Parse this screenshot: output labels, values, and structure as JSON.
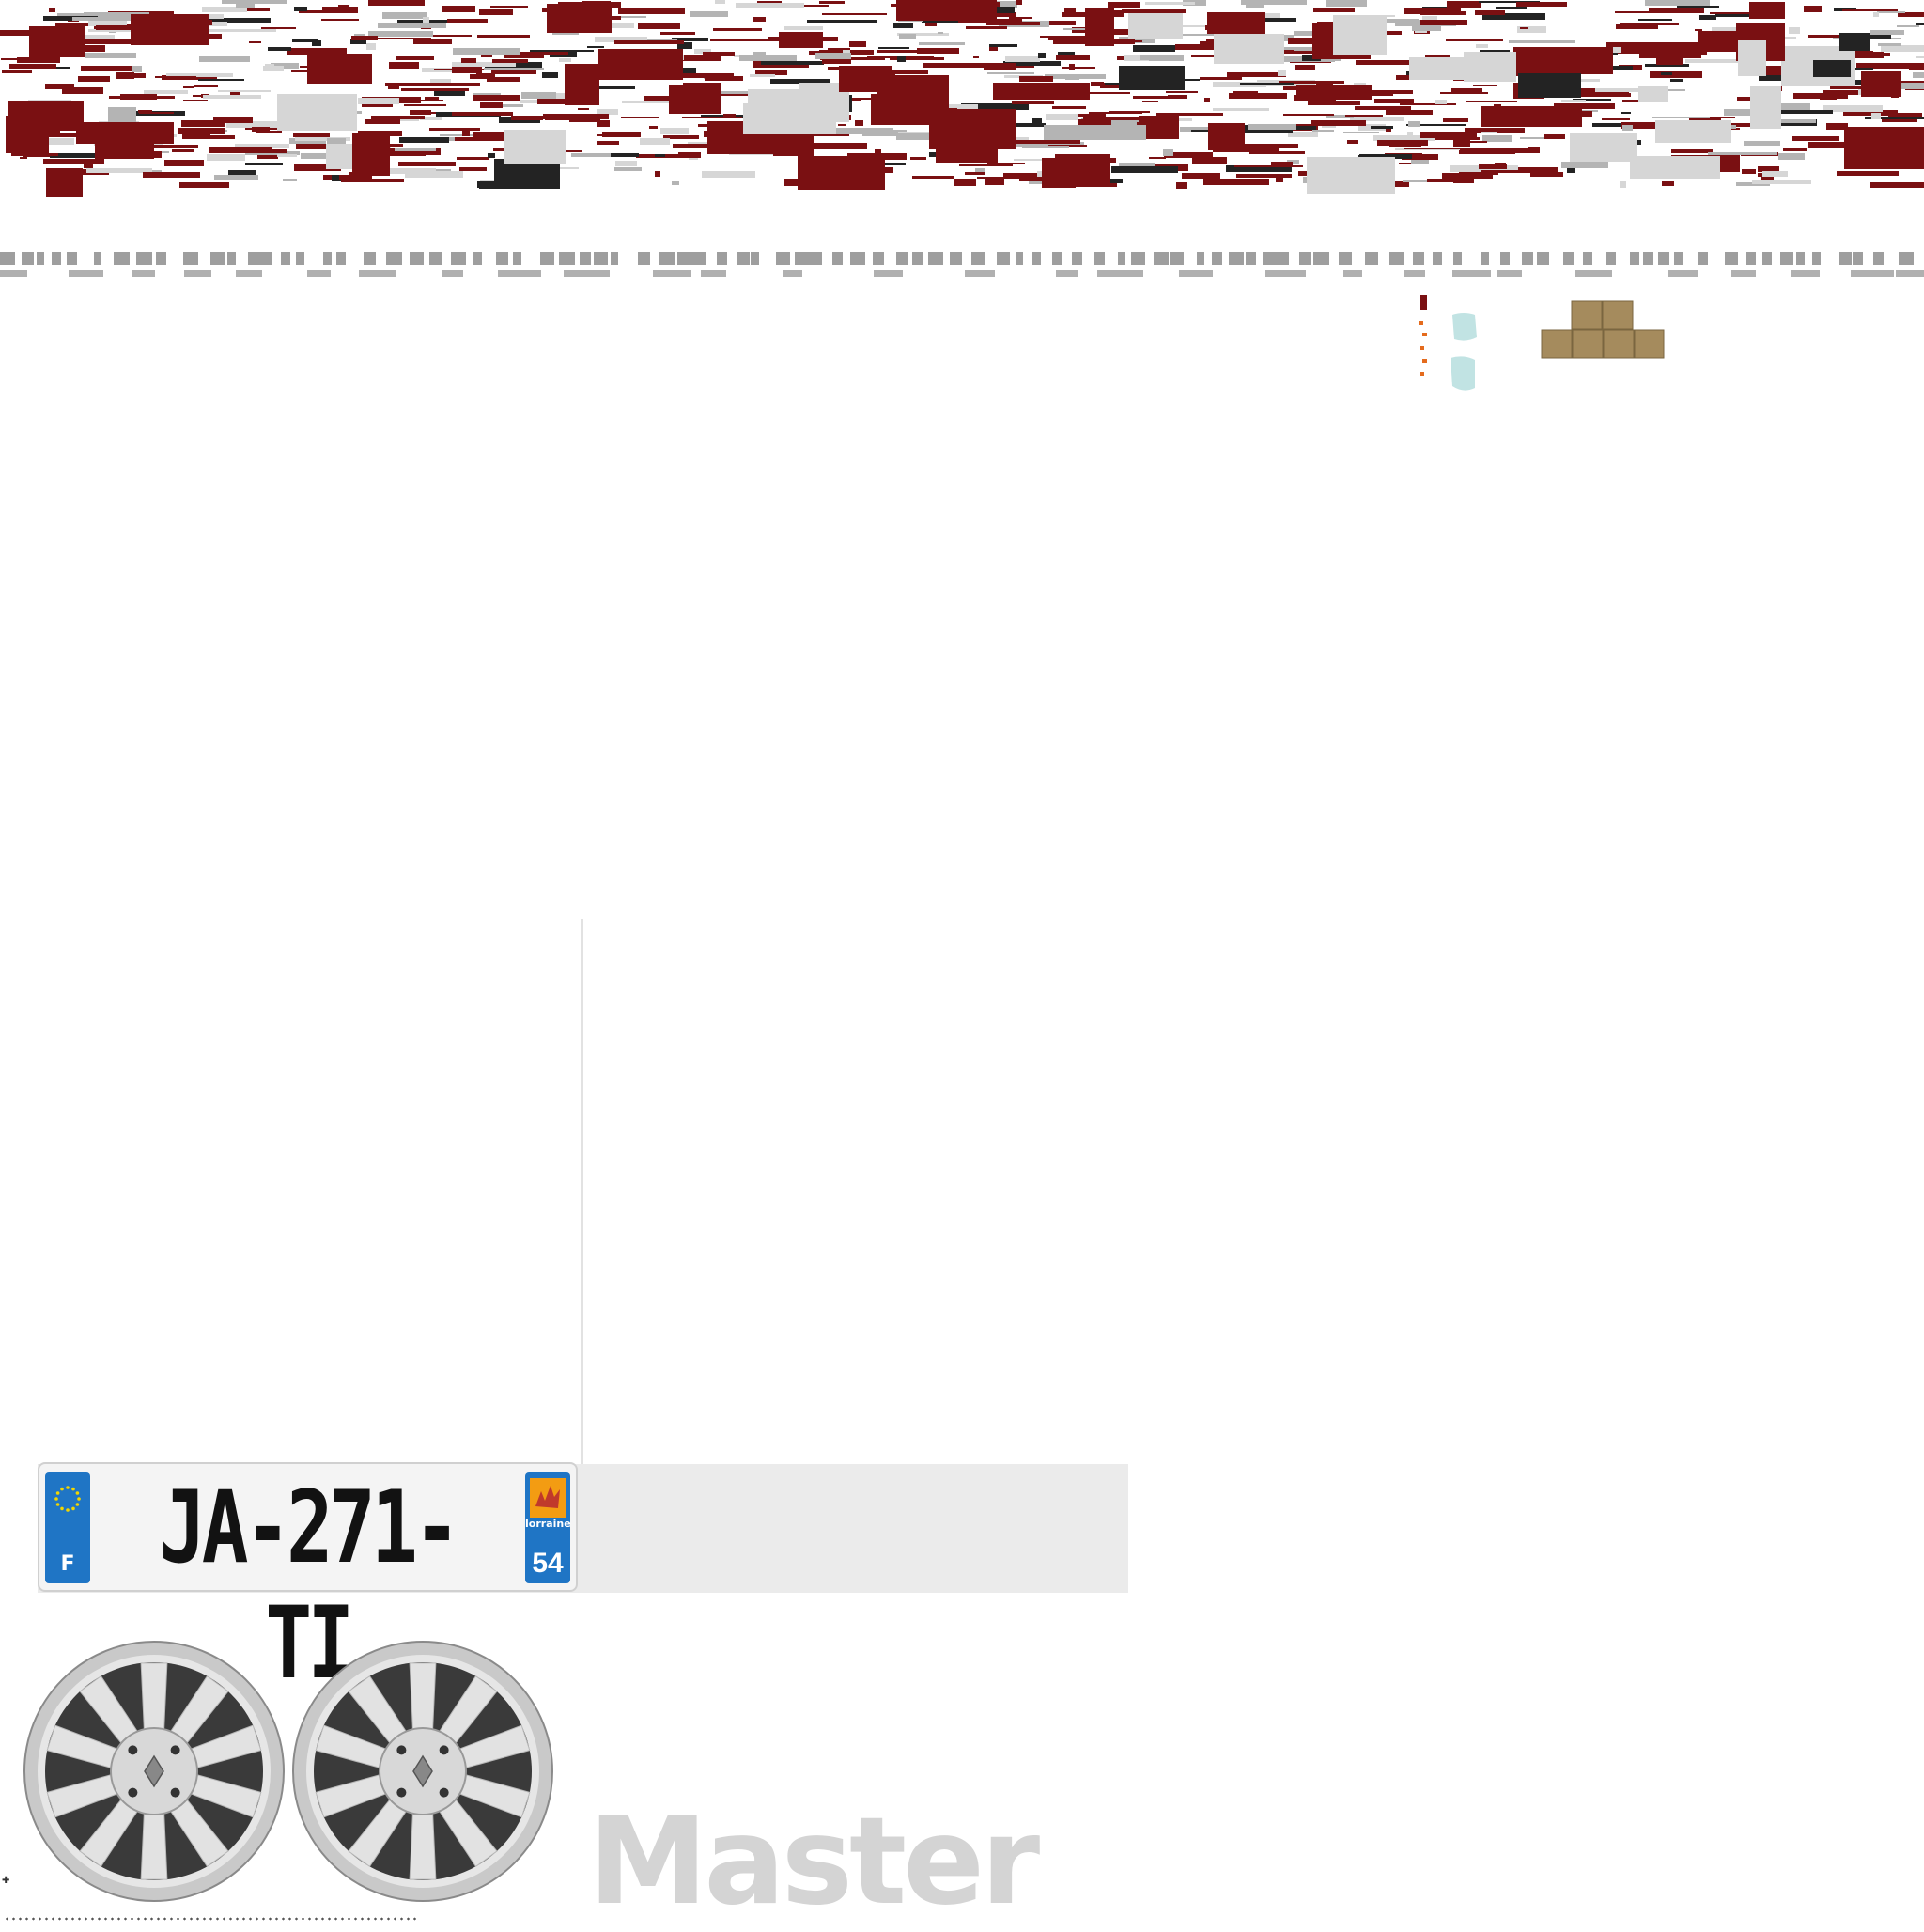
{
  "texture_sheet": {
    "palette": {
      "maroon": "#7a1012",
      "dark": "#232323",
      "grey": "#b4b4b4",
      "light_grey": "#d6d6d6",
      "background": "#ffffff",
      "plate_blue": "#1f75c5",
      "cardboard": "#a58b5d",
      "glass": "#b6dede"
    },
    "license_plate": {
      "number": "JA-271-TI",
      "country_code": "F",
      "region": "lorraine",
      "department": "54"
    },
    "brand_logo": {
      "text": "Master"
    },
    "wheels": {
      "count": 2,
      "icon": "renault-diamond-icon"
    },
    "props": {
      "boxes": "cardboard-boxes-icon",
      "glass": "glass-panel-icon",
      "clips": "orange-clips-icon"
    }
  }
}
